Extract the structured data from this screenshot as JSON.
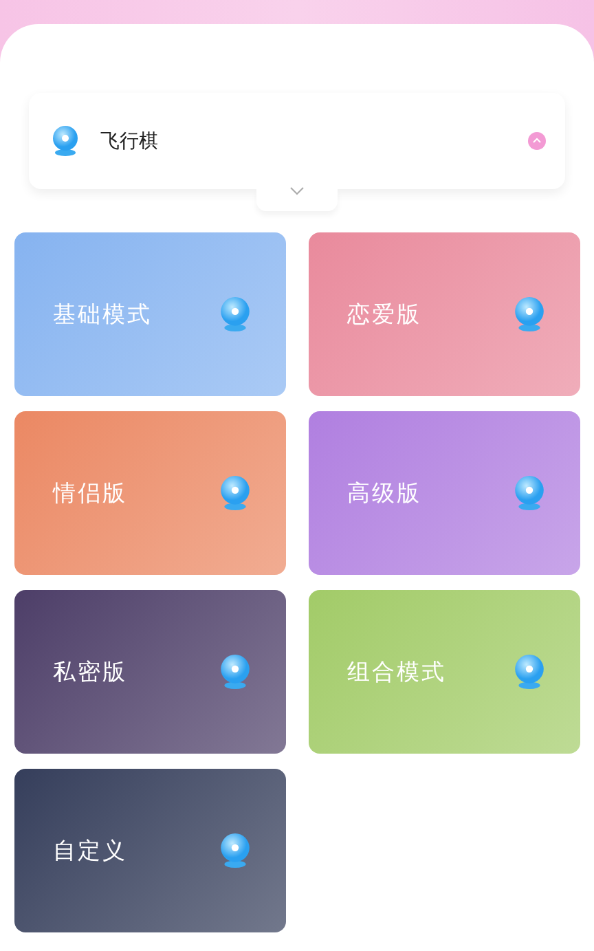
{
  "selector": {
    "title": "飞行棋"
  },
  "modes": [
    {
      "label": "基础模式",
      "color": "#86b3f0"
    },
    {
      "label": "恋爱版",
      "color": "#e98a9c"
    },
    {
      "label": "情侣版",
      "color": "#eb8863"
    },
    {
      "label": "高级版",
      "color": "#b07fe0"
    },
    {
      "label": "私密版",
      "color": "#4d3e68"
    },
    {
      "label": "组合模式",
      "color": "#a2cb68"
    },
    {
      "label": "自定义",
      "color": "#353e5b"
    }
  ]
}
